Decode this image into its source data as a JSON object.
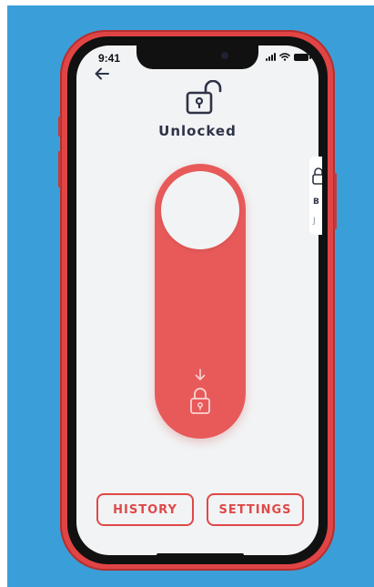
{
  "status_bar": {
    "time": "9:41",
    "icons": [
      "signal-icon",
      "wifi-icon",
      "battery-icon"
    ]
  },
  "header": {
    "back_icon": "arrow-left-icon",
    "status_icon": "unlocked-padlock-icon",
    "title": "Unlocked"
  },
  "lock_slider": {
    "state": "unlocked",
    "knob_position": "top",
    "hint_icon": "arrow-down-icon",
    "target_icon": "locked-padlock-icon",
    "track_color": "#e85a5a",
    "knob_color": "#f2f3f4"
  },
  "peek_card": {
    "line1": "B",
    "line2": "J"
  },
  "actions": {
    "history_label": "HISTORY",
    "settings_label": "SETTINGS"
  },
  "colors": {
    "accent": "#e04848",
    "background": "#3a9fd8",
    "screen": "#f2f3f4",
    "text_dark": "#2e3347",
    "phone_body": "#e04444"
  }
}
